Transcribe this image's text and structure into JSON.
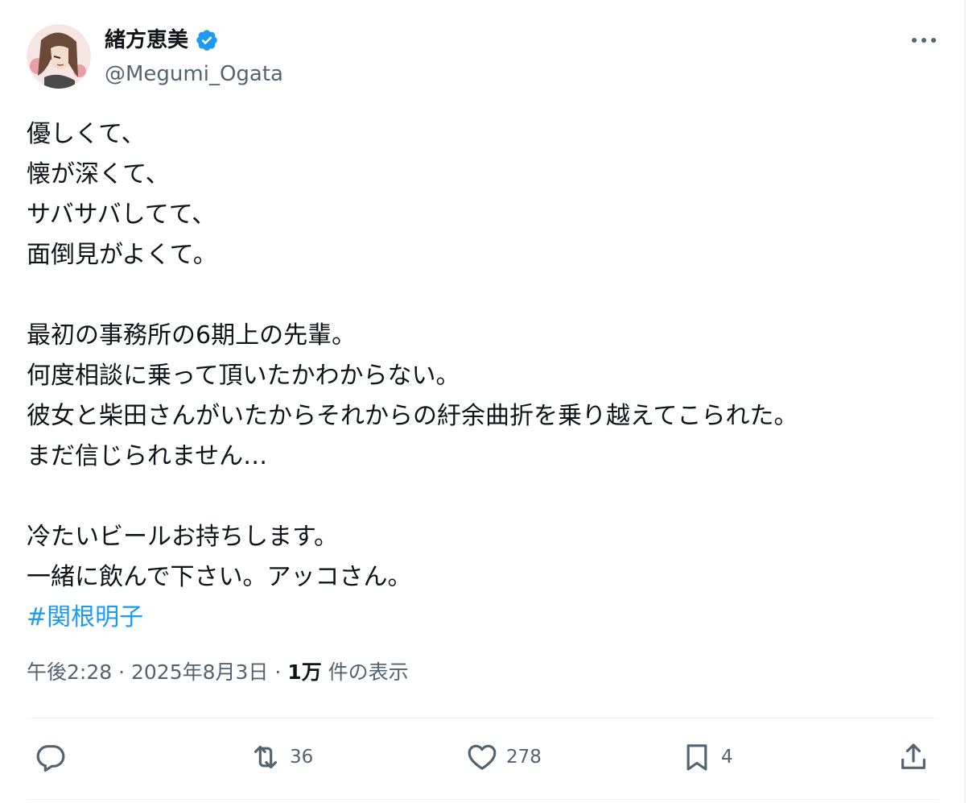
{
  "author": {
    "name": "緒方恵美",
    "handle": "@Megumi_Ogata",
    "verified": true,
    "avatar_icon": "avatar-illustration"
  },
  "menu": {
    "icon": "more-dots-icon"
  },
  "tweet": {
    "lines": [
      "優しくて、",
      "懐が深くて、",
      "サバサバしてて、",
      "面倒見がよくて。",
      "",
      "最初の事務所の6期上の先輩。",
      "何度相談に乗って頂いたかわからない。",
      "彼女と柴田さんがいたからそれからの紆余曲折を乗り越えてこられた。",
      "まだ信じられません…",
      "",
      "冷たいビールお持ちします。",
      "一緒に飲んで下さい。アッコさん。"
    ],
    "hashtag": "#関根明子"
  },
  "meta": {
    "time": "午後2:28",
    "sep1": "·",
    "date": "2025年8月3日",
    "sep2": "·",
    "views": "1万",
    "views_label": "件の表示"
  },
  "actions": {
    "reply": {
      "icon": "reply-icon",
      "count": ""
    },
    "retweet": {
      "icon": "retweet-icon",
      "count": "36"
    },
    "like": {
      "icon": "heart-icon",
      "count": "278"
    },
    "bookmark": {
      "icon": "bookmark-icon",
      "count": "4"
    },
    "share": {
      "icon": "share-icon",
      "count": ""
    }
  },
  "colors": {
    "accent": "#1d9bf0",
    "secondary_text": "#536471",
    "text": "#0f1419",
    "divider": "#eff3f4"
  }
}
